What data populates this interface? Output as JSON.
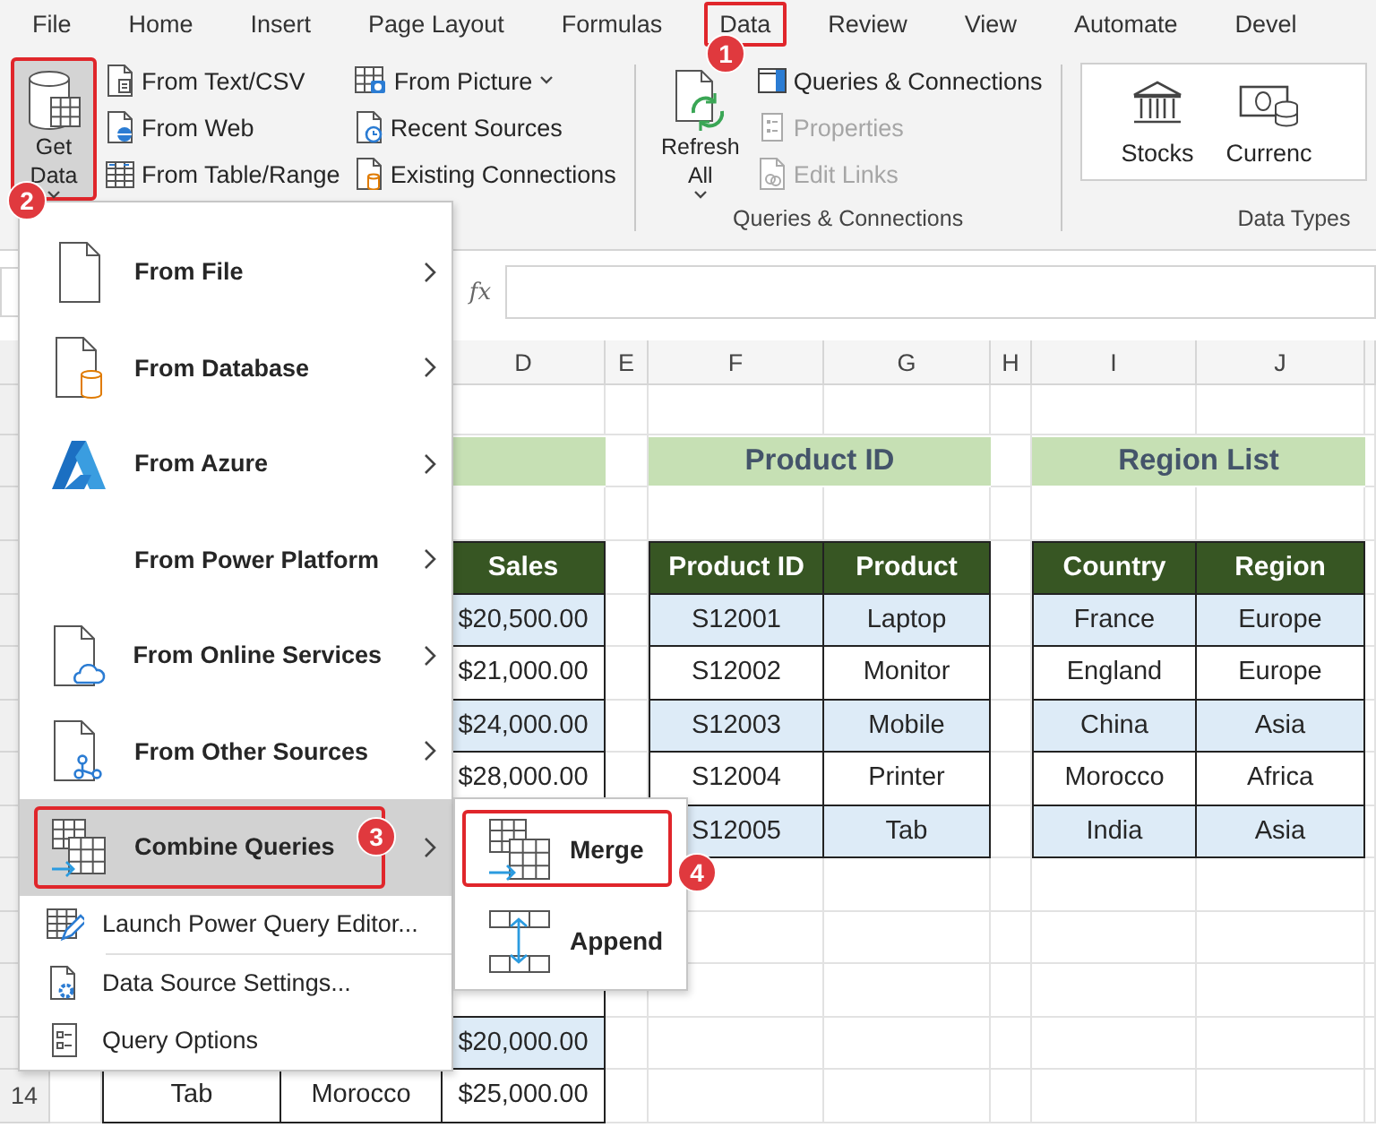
{
  "menu_tabs": [
    {
      "label": "File",
      "highlighted": false
    },
    {
      "label": "Home",
      "highlighted": false
    },
    {
      "label": "Insert",
      "highlighted": false
    },
    {
      "label": "Page Layout",
      "highlighted": false
    },
    {
      "label": "Formulas",
      "highlighted": false
    },
    {
      "label": "Data",
      "highlighted": true
    },
    {
      "label": "Review",
      "highlighted": false
    },
    {
      "label": "View",
      "highlighted": false
    },
    {
      "label": "Automate",
      "highlighted": false
    },
    {
      "label": "Devel",
      "highlighted": false
    }
  ],
  "ribbon": {
    "get_data": {
      "label": "Get Data",
      "pressed": true,
      "highlighted": true
    },
    "source_items": [
      {
        "label": "From Text/CSV",
        "has_menu": false
      },
      {
        "label": "From Web",
        "has_menu": false
      },
      {
        "label": "From Table/Range",
        "has_menu": false
      }
    ],
    "source_items_2": [
      {
        "label": "From Picture",
        "has_menu": true
      },
      {
        "label": "Recent Sources",
        "has_menu": false
      },
      {
        "label": "Existing Connections",
        "has_menu": false
      }
    ],
    "refresh_all": {
      "label": "Refresh All"
    },
    "queries_items": [
      {
        "label": "Queries & Connections",
        "disabled": false
      },
      {
        "label": "Properties",
        "disabled": true
      },
      {
        "label": "Edit Links",
        "disabled": true
      }
    ],
    "queries_group_label": "Queries & Connections",
    "data_types": [
      {
        "label": "Stocks"
      },
      {
        "label": "Currenc"
      }
    ],
    "data_types_group_label": "Data Types"
  },
  "formula_bar": {
    "function_label": "fx"
  },
  "sheet": {
    "column_headers": [
      "D",
      "E",
      "F",
      "G",
      "H",
      "I",
      "J"
    ],
    "row_header": "14",
    "titles": [
      "Product ID",
      "Region List"
    ],
    "sales_table": {
      "header": "Sales",
      "rows": [
        {
          "D": "$20,500.00"
        },
        {
          "D": "$21,000.00"
        },
        {
          "D": "$24,000.00"
        },
        {
          "D": "$28,000.00"
        }
      ],
      "rows_after_gap": [
        {
          "D": "$20,000.00"
        },
        {
          "B": "Tab",
          "C": "Morocco",
          "D": "$25,000.00"
        }
      ]
    },
    "tables": [
      {
        "headers": [
          "Product ID",
          "Product"
        ],
        "rows": [
          [
            "S12001",
            "Laptop"
          ],
          [
            "S12002",
            "Monitor"
          ],
          [
            "S12003",
            "Mobile"
          ],
          [
            "S12004",
            "Printer"
          ],
          [
            "S12005",
            "Tab"
          ]
        ]
      },
      {
        "headers": [
          "Country",
          "Region"
        ],
        "rows": [
          [
            "France",
            "Europe"
          ],
          [
            "England",
            "Europe"
          ],
          [
            "China",
            "Asia"
          ],
          [
            "Morocco",
            "Africa"
          ],
          [
            "India",
            "Asia"
          ]
        ]
      }
    ]
  },
  "get_data_menu": [
    {
      "label": "From File",
      "kind": "submenu",
      "selected": false,
      "highlighted": false
    },
    {
      "label": "From Database",
      "kind": "submenu",
      "selected": false,
      "highlighted": false
    },
    {
      "label": "From Azure",
      "kind": "submenu",
      "selected": false,
      "highlighted": false
    },
    {
      "label": "From Power Platform",
      "kind": "submenu",
      "selected": false,
      "highlighted": false
    },
    {
      "label": "From Online Services",
      "kind": "submenu",
      "selected": false,
      "highlighted": false
    },
    {
      "label": "From Other Sources",
      "kind": "submenu",
      "selected": false,
      "highlighted": false
    },
    {
      "label": "Combine Queries",
      "kind": "submenu",
      "selected": true,
      "highlighted": true
    },
    {
      "label": "Launch Power Query Editor...",
      "kind": "command",
      "selected": false
    },
    {
      "label": "Data Source Settings...",
      "kind": "command",
      "selected": false
    },
    {
      "label": "Query Options",
      "kind": "command",
      "selected": false
    }
  ],
  "combine_submenu": [
    {
      "label": "Merge",
      "highlighted": true
    },
    {
      "label": "Append",
      "highlighted": false
    }
  ],
  "callouts": [
    "1",
    "2",
    "3",
    "4"
  ]
}
